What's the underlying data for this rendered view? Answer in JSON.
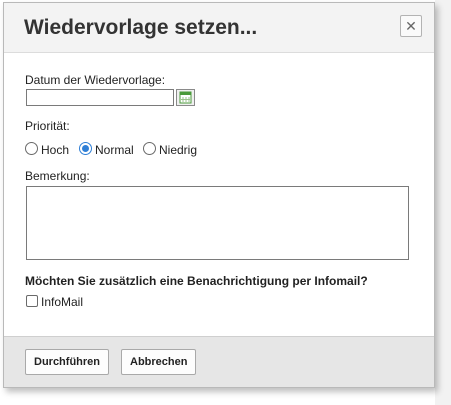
{
  "dialog": {
    "title": "Wiedervorlage setzen...",
    "close_glyph": "✕"
  },
  "form": {
    "date_label": "Datum der Wiedervorlage:",
    "date_value": "",
    "priority_label": "Priorität:",
    "priority_options": [
      {
        "label": "Hoch",
        "checked": false
      },
      {
        "label": "Normal",
        "checked": true
      },
      {
        "label": "Niedrig",
        "checked": false
      }
    ],
    "remark_label": "Bemerkung:",
    "remark_value": "",
    "notify_question": "Möchten Sie zusätzlich eine Benachrichtigung per Infomail?",
    "infomail_label": "InfoMail",
    "infomail_checked": false
  },
  "footer": {
    "execute_label": "Durchführen",
    "cancel_label": "Abbrechen"
  },
  "icons": {
    "close": "close-icon",
    "calendar": "calendar-icon",
    "resize": "resize-grip-icon"
  },
  "colors": {
    "accent": "#2f7fd6",
    "header_bg": "#f3f3f3",
    "footer_bg": "#e6e6e6",
    "calendar_green": "#4a9a3a"
  }
}
